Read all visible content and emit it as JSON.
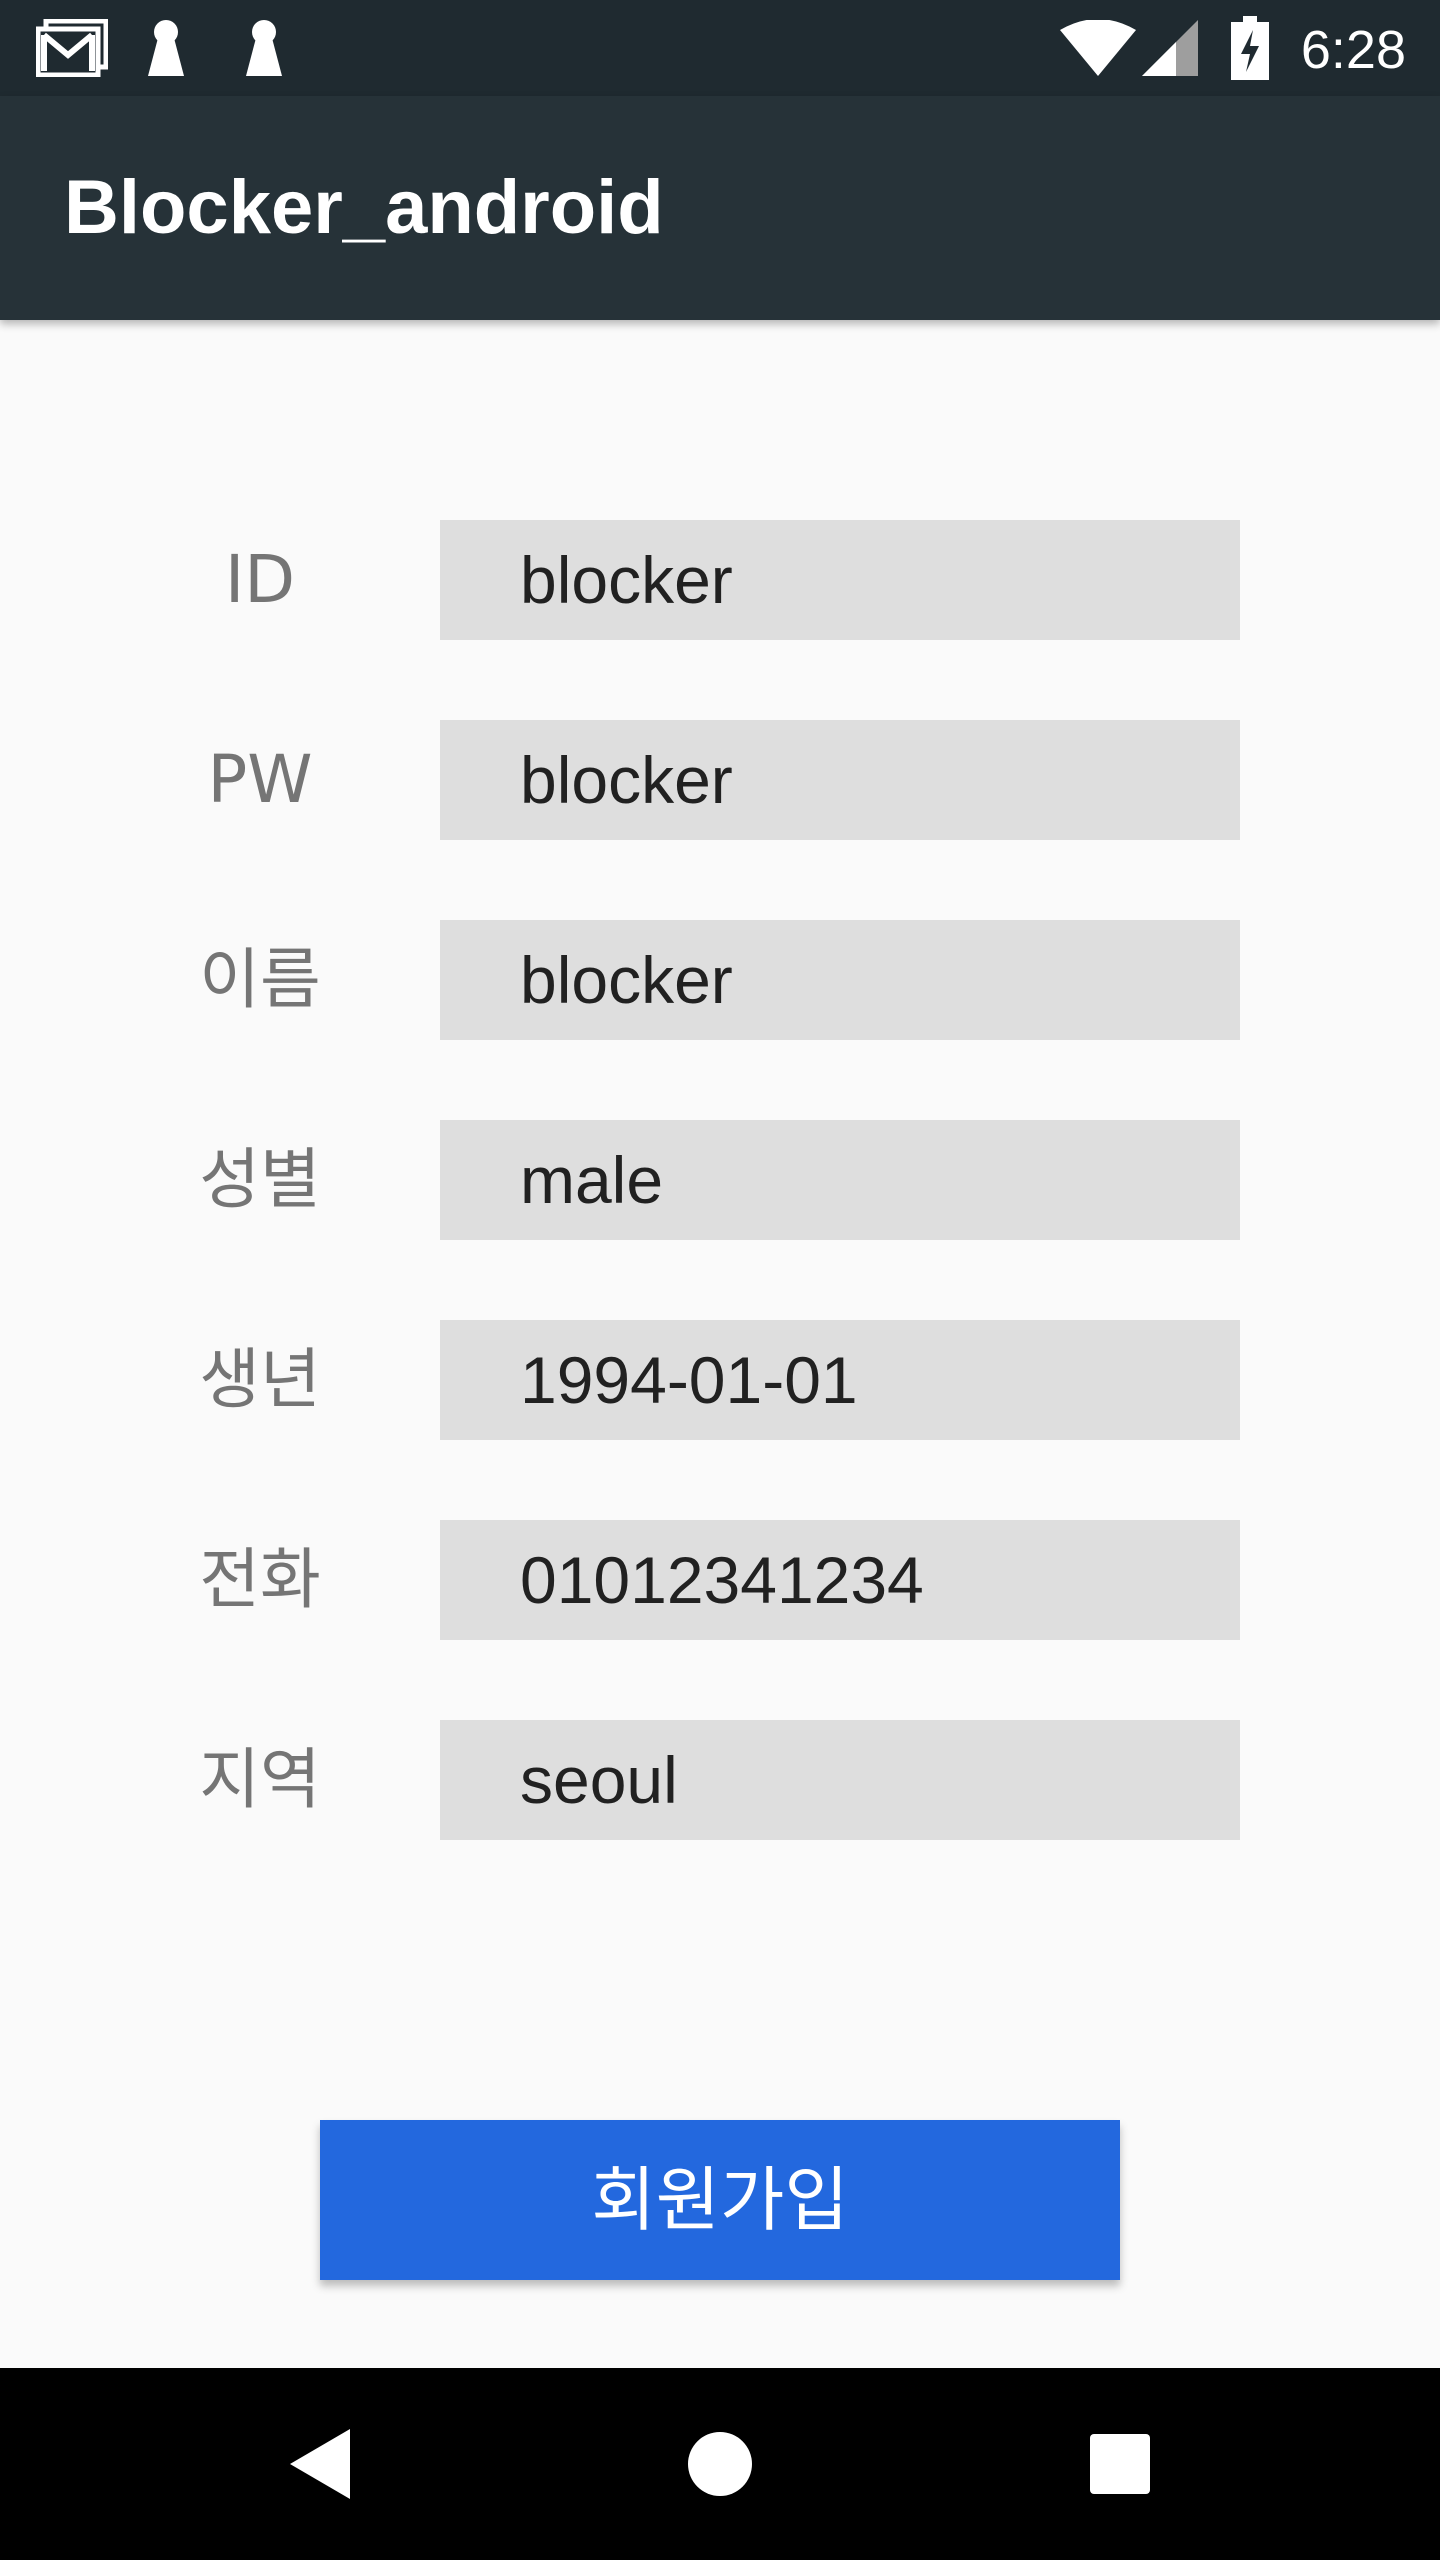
{
  "status_bar": {
    "time": "6:28",
    "icons": [
      "gmail-icon",
      "keyhole-icon",
      "keyhole-icon",
      "wifi-icon",
      "cell-signal-icon",
      "battery-charging-icon"
    ]
  },
  "app_bar": {
    "title": "Blocker_android"
  },
  "form": {
    "fields": [
      {
        "label": "ID",
        "value": "blocker"
      },
      {
        "label": "PW",
        "value": "blocker"
      },
      {
        "label": "이름",
        "value": "blocker"
      },
      {
        "label": "성별",
        "value": "male"
      },
      {
        "label": "생년",
        "value": "1994-01-01"
      },
      {
        "label": "전화",
        "value": "01012341234"
      },
      {
        "label": "지역",
        "value": "seoul"
      }
    ]
  },
  "signup_button": {
    "label": "회원가입"
  },
  "nav_bar": {
    "buttons": [
      "back-icon",
      "home-icon",
      "recents-icon"
    ]
  },
  "colors": {
    "status_bar": "#1f2a30",
    "app_bar": "#263238",
    "background": "#fafafa",
    "input_fill": "#dedede",
    "button": "#2368de",
    "label_text": "#757575"
  }
}
